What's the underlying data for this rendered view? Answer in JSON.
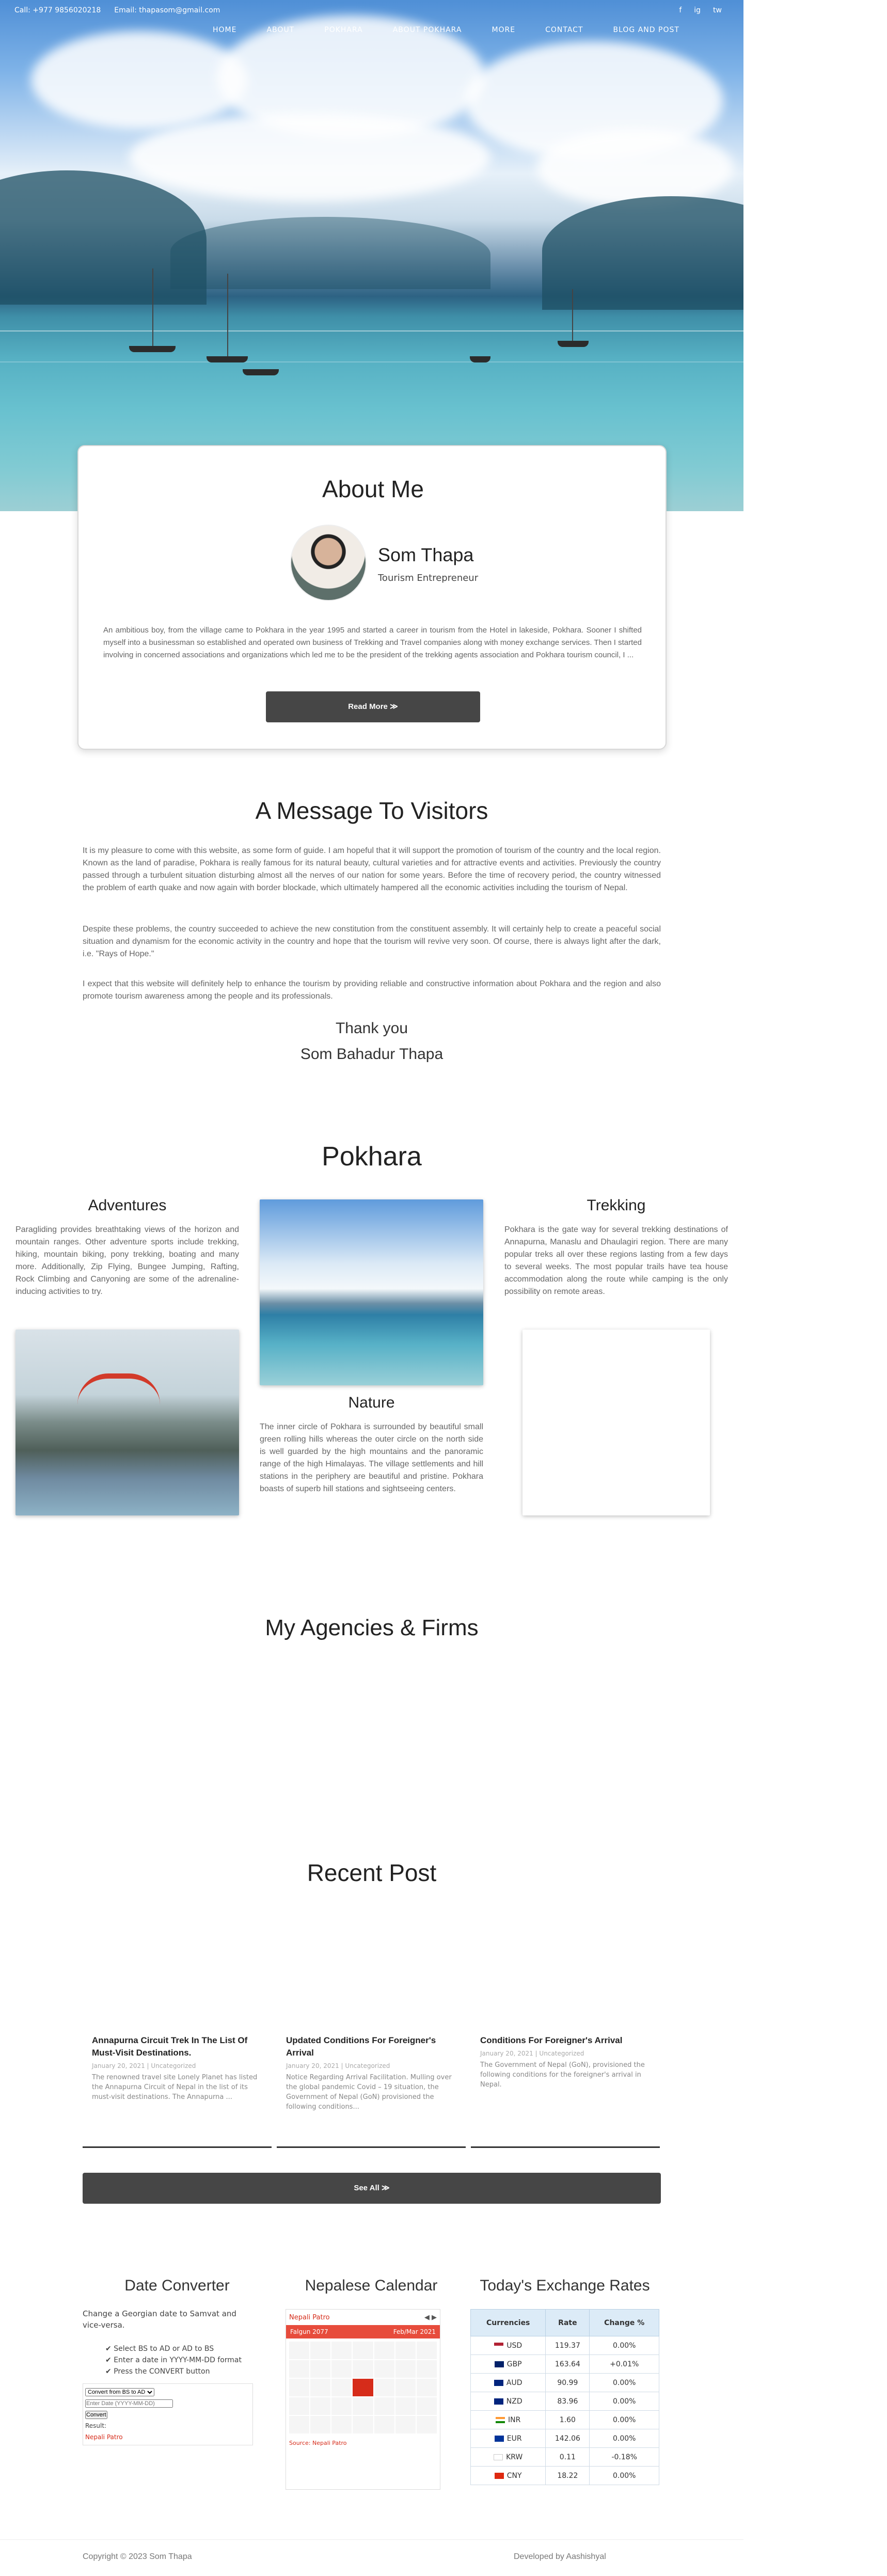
{
  "topbar": {
    "phone": "Call: +977 9856020218",
    "email": "Email: thapasom@gmail.com",
    "social": [
      "f",
      "ig",
      "tw"
    ]
  },
  "nav": [
    "HOME",
    "ABOUT",
    "POKHARA",
    "ABOUT POKHARA",
    "MORE",
    "CONTACT",
    "BLOG AND POST"
  ],
  "about": {
    "title": "About Me",
    "name": "Som Thapa",
    "role": "Tourism Entrepreneur",
    "text": "An ambitious boy, from the village came to Pokhara in the year 1995 and started a career in tourism from the Hotel in lakeside, Pokhara. Sooner I shifted myself into a businessman so established and operated own business of Trekking and Travel companies along with money exchange services. Then I started involving in concerned associations and organizations which led me to be the president of the trekking agents association and Pokhara tourism council, I ...",
    "button": "Read More"
  },
  "message": {
    "title": "A Message To Visitors",
    "p1": "It is my pleasure to come with this website, as some form of guide. I am hopeful that it will support the promotion of tourism of the country and the local region. Known as the land of paradise, Pokhara is really famous for its natural beauty, cultural varieties and for attractive events and activities. Previously the country passed through a turbulent situation disturbing almost all the nerves of our nation for some years. Before the time of recovery period, the country witnessed the problem of earth quake and now again with border blockade, which ultimately hampered all the economic activities including the tourism of Nepal.",
    "p2": "Despite these problems, the country succeeded to achieve the new constitution from the constituent assembly. It will certainly help to create a peaceful social situation and dynamism for the economic activity in the country and hope that the tourism will revive very soon. Of course, there is always light after the dark, i.e. \"Rays of Hope.\"",
    "p3": "I expect that this website will definitely help to enhance the tourism by providing reliable and constructive information about Pokhara and the region and also promote tourism awareness among the people and its professionals.",
    "thanks": "Thank you",
    "signature": "Som Bahadur Thapa"
  },
  "pokhara": {
    "title": "Pokhara",
    "adventures": {
      "title": "Adventures",
      "text": "Paragliding provides breathtaking views of the horizon and mountain ranges. Other adventure sports include trekking, hiking, mountain biking, pony trekking, boating and many more. Additionally, Zip Flying, Bungee Jumping, Rafting, Rock Climbing and Canyoning are some of the adrenaline-inducing activities to try."
    },
    "trekking": {
      "title": "Trekking",
      "text": "Pokhara is the gate way for several trekking destinations of Annapurna, Manaslu and Dhaulagiri region. There are many popular treks all over these regions lasting from a few days to several weeks. The most popular trails have tea house accommodation along the route while camping is the only possibility on remote areas."
    },
    "nature": {
      "title": "Nature",
      "text": "The inner circle of Pokhara is surrounded by beautiful small green rolling hills whereas the outer circle on the north side is well guarded by the high mountains and the panoramic range of the high Himalayas. The village settlements and hill stations in the periphery are beautiful and pristine. Pokhara boasts of superb hill stations and sightseeing centers."
    }
  },
  "agencies": {
    "title": "My Agencies & Firms"
  },
  "recent": {
    "title": "Recent Post",
    "posts": [
      {
        "title": "Annapurna Circuit Trek In The List Of Must-Visit Destinations.",
        "meta": "January 20, 2021  |  Uncategorized",
        "text": "The renowned travel site Lonely Planet has listed the Annapurna Circuit of Nepal in the list of its must-visit destinations. The Annapurna ..."
      },
      {
        "title": "Updated Conditions For Foreigner's Arrival",
        "meta": "January 20, 2021  |  Uncategorized",
        "text": "Notice Regarding Arrival Facilitation. Mulling over the global pandemic Covid – 19 situation, the Government of Nepal (GoN) provisioned the following conditions..."
      },
      {
        "title": "Conditions For Foreigner's Arrival",
        "meta": "January 20, 2021  |  Uncategorized",
        "text": "The Government of Nepal (GoN), provisioned the following conditions for the foreigner's arrival in Nepal."
      }
    ],
    "button": "See All"
  },
  "widgets": {
    "converter": {
      "title": "Date Converter",
      "intro": "Change a Georgian date to Samvat and vice-versa.",
      "steps": [
        "Select BS to AD or AD to BS",
        "Enter a date in YYYY-MM-DD format",
        "Press the CONVERT button"
      ],
      "select": "Convert from BS to AD",
      "placeholder": "Enter Date (YYYY-MM-DD)",
      "button": "Convert",
      "result": "Result:",
      "credit": "Nepali Patro"
    },
    "calendar": {
      "title": "Nepalese Calendar",
      "brand": "Nepali Patro",
      "month_bs": "Falgun 2077",
      "month_ad": "Feb/Mar 2021",
      "footer": "Source: Nepali Patro"
    },
    "rates": {
      "title": "Today's Exchange Rates",
      "headers": [
        "Currencies",
        "Rate",
        "Change %"
      ],
      "rows": [
        [
          "USD",
          "119.37",
          "0.00%"
        ],
        [
          "GBP",
          "163.64",
          "+0.01%"
        ],
        [
          "AUD",
          "90.99",
          "0.00%"
        ],
        [
          "NZD",
          "83.96",
          "0.00%"
        ],
        [
          "INR",
          "1.60",
          "0.00%"
        ],
        [
          "EUR",
          "142.06",
          "0.00%"
        ],
        [
          "KRW",
          "0.11",
          "-0.18%"
        ],
        [
          "CNY",
          "18.22",
          "0.00%"
        ]
      ]
    }
  },
  "footer": {
    "copyright": "Copyright © 2023 Som Thapa",
    "credit": "Developed by Aashishyal"
  }
}
